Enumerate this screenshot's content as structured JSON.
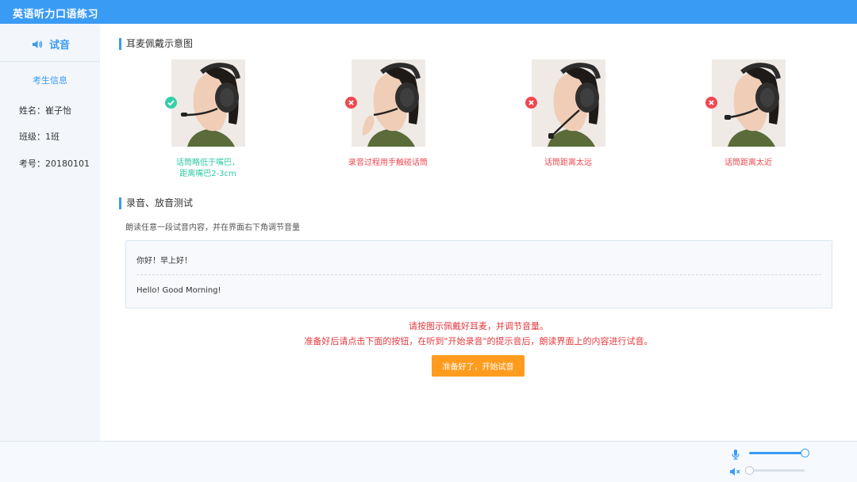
{
  "app": {
    "title": "英语听力口语练习"
  },
  "sidebar": {
    "tab_label": "试音",
    "student_info_title": "考生信息",
    "fields": [
      {
        "label": "姓名：",
        "value": "崔子怡"
      },
      {
        "label": "班级：",
        "value": "1班"
      },
      {
        "label": "考号：",
        "value": "20180101"
      }
    ]
  },
  "headset_section": {
    "title": "耳麦佩戴示意图",
    "examples": [
      {
        "status": "correct",
        "caption_line1": "话筒略低于嘴巴，",
        "caption_line2": "距离嘴巴2-3cm"
      },
      {
        "status": "wrong",
        "caption_line1": "录音过程用手触碰话筒",
        "caption_line2": ""
      },
      {
        "status": "wrong",
        "caption_line1": "话筒距离太远",
        "caption_line2": ""
      },
      {
        "status": "wrong",
        "caption_line1": "话筒距离太近",
        "caption_line2": ""
      }
    ]
  },
  "test_section": {
    "title": "录音、放音测试",
    "instruction": "朗读任意一段试音内容，并在界面右下角调节音量",
    "reading_zh": "你好！早上好！",
    "reading_en": "Hello! Good Morning!",
    "notice_line1": "请按图示佩戴好耳麦，并调节音量。",
    "notice_line2": "准备好后请点击下面的按钮，在听到\"开始录音\"的提示音后，朗读界面上的内容进行试音。",
    "start_button": "准备好了，开始试音"
  },
  "volume": {
    "mic_level": 1.0,
    "speaker_level": 0.0
  },
  "colors": {
    "accent": "#3a9bf5",
    "correct": "#2cc9a4",
    "wrong": "#f0484f",
    "button": "#ff9c1e"
  }
}
